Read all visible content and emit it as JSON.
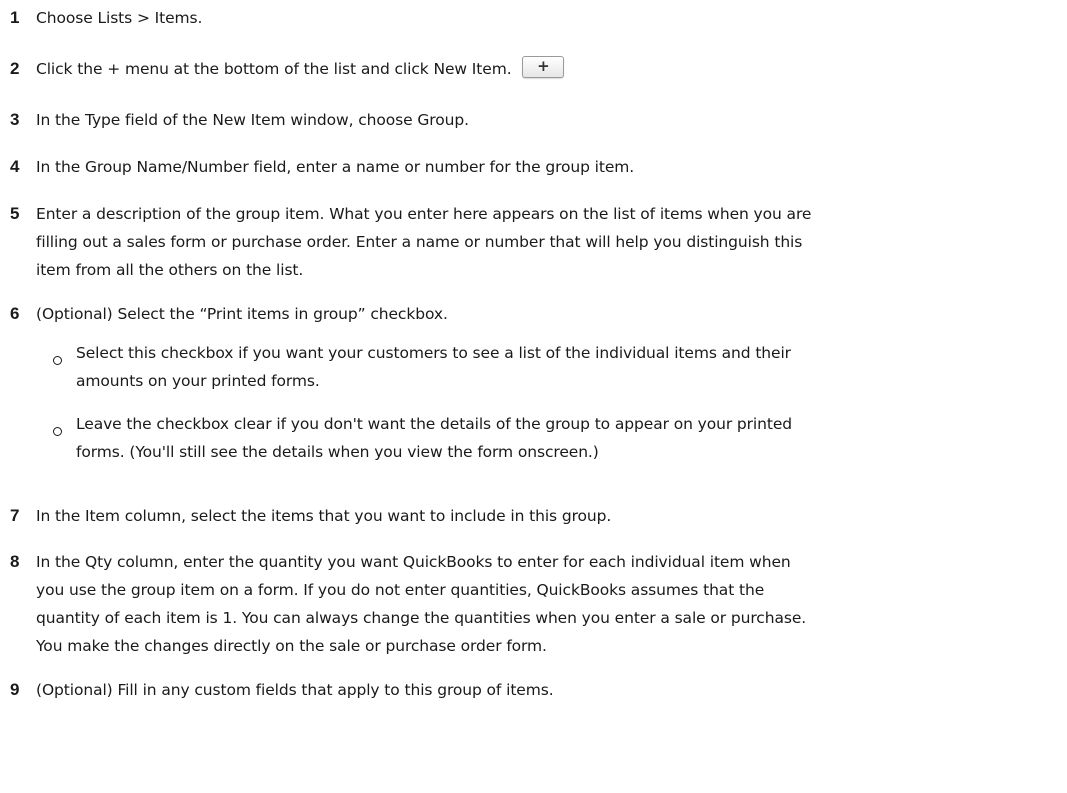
{
  "steps": [
    {
      "number": "1",
      "text": "Choose Lists > Items."
    },
    {
      "number": "2",
      "text": "Click the + menu at the bottom of the list and click New Item.",
      "button_icon": "plus-icon",
      "button_glyph": "+"
    },
    {
      "number": "3",
      "text": "In the Type field of the New Item window, choose Group."
    },
    {
      "number": "4",
      "text": "In the Group Name/Number field, enter a name or number for the group item."
    },
    {
      "number": "5",
      "lines": [
        "Enter a description of the group item. What you enter here appears on the list of items when you are",
        "filling out a sales form or purchase order. Enter a name or number that will help you distinguish this",
        "item from all the others on the list."
      ]
    },
    {
      "number": "6",
      "text": "(Optional) Select the “Print items in group” checkbox.",
      "bullets": [
        {
          "lines": [
            "Select this checkbox if you want your customers to see a list of the individual items and their",
            "amounts on your printed forms."
          ]
        },
        {
          "lines": [
            "Leave the checkbox clear if you don't want the details of the group to appear on your printed",
            "forms. (You'll still see the details when you view the form onscreen.)"
          ]
        }
      ]
    },
    {
      "number": "7",
      "text": "In the Item column, select the items that you want to include in this group."
    },
    {
      "number": "8",
      "lines": [
        "In the Qty column, enter the quantity you want QuickBooks to enter for each individual item when",
        "you use the group item on a form. If you do not enter quantities, QuickBooks assumes that the",
        "quantity of each item is 1. You can always change the quantities when you enter a sale or purchase.",
        "You make the changes directly on the sale or purchase order form."
      ]
    },
    {
      "number": "9",
      "text": "(Optional) Fill in any custom fields that apply to this group of items."
    }
  ]
}
